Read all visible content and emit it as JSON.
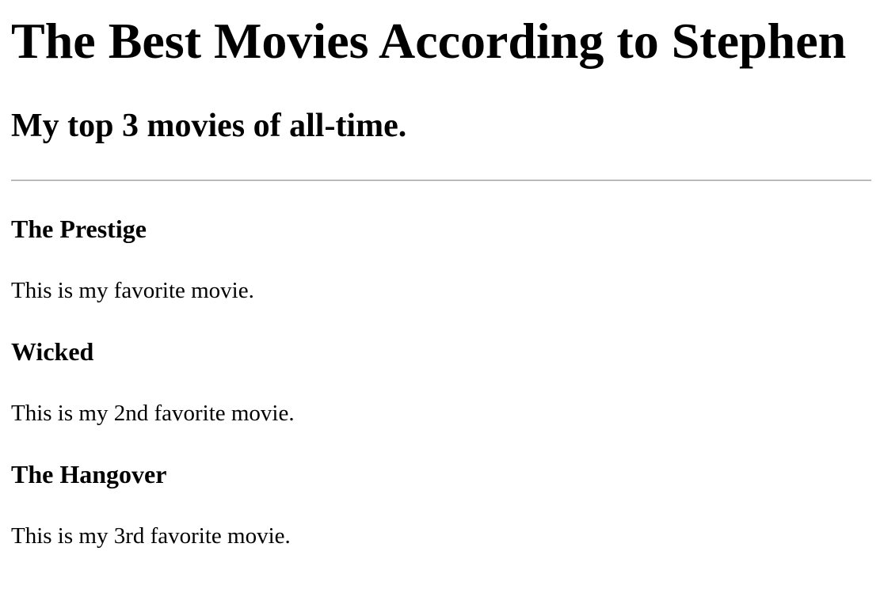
{
  "header": {
    "title": "The Best Movies According to Stephen",
    "subtitle": "My top 3 movies of all-time."
  },
  "movies": [
    {
      "title": "The Prestige",
      "description": "This is my favorite movie."
    },
    {
      "title": "Wicked",
      "description": "This is my 2nd favorite movie."
    },
    {
      "title": "The Hangover",
      "description": "This is my 3rd favorite movie."
    }
  ]
}
